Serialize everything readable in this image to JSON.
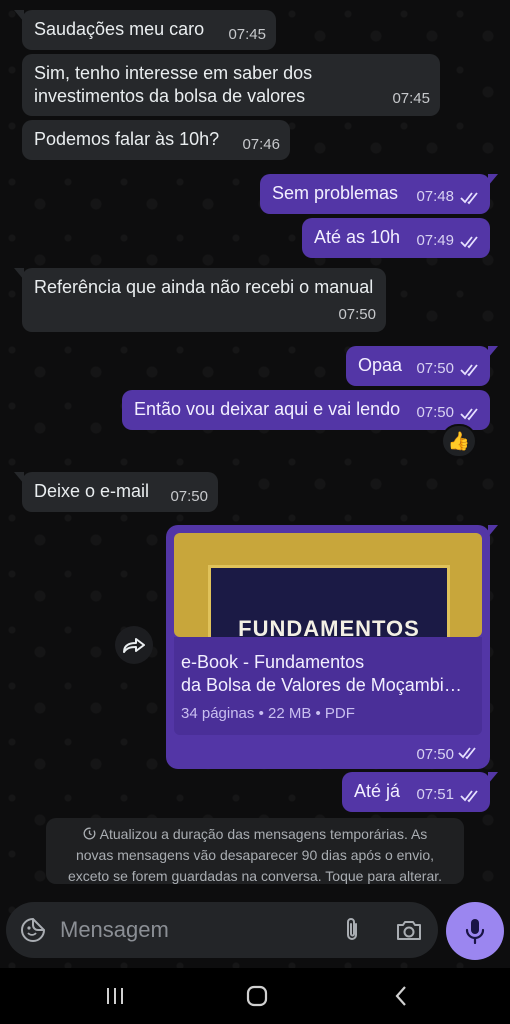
{
  "messages": [
    {
      "text": "Saudações meu caro",
      "time": "07:45"
    },
    {
      "line1": "Sim, tenho interesse em saber dos",
      "line2": "investimentos da bolsa de valores",
      "time": "07:45"
    },
    {
      "text": "Podemos falar às 10h?",
      "time": "07:46"
    },
    {
      "text": "Sem problemas",
      "time": "07:48"
    },
    {
      "text": "Até as 10h",
      "time": "07:49"
    },
    {
      "text": "Referência que ainda não recebi o manual",
      "time": "07:50"
    },
    {
      "text": "Opaa",
      "time": "07:50"
    },
    {
      "text": "Então vou deixar aqui e vai lendo",
      "time": "07:50",
      "reaction": "👍"
    },
    {
      "text": "Deixe o e-mail",
      "time": "07:50"
    },
    {
      "text": "Até já",
      "time": "07:51"
    }
  ],
  "ebook": {
    "cover_text": "FUNDAMENTOS",
    "title_line1": "e-Book - Fundamentos",
    "title_line2": "da Bolsa de Valores de Moçambique",
    "meta": "34 páginas • 22 MB • PDF",
    "time": "07:50"
  },
  "notice": {
    "line1": "Atualizou a duração das mensagens temporárias. As",
    "line2": "novas mensagens vão desaparecer 90 dias após o envio,",
    "line3": "exceto se forem guardadas na conversa. Toque para alterar."
  },
  "composer": {
    "placeholder": "Mensagem"
  },
  "colors": {
    "outgoing": "#5336a6",
    "incoming": "#26282b",
    "mic": "#9b86f0"
  }
}
